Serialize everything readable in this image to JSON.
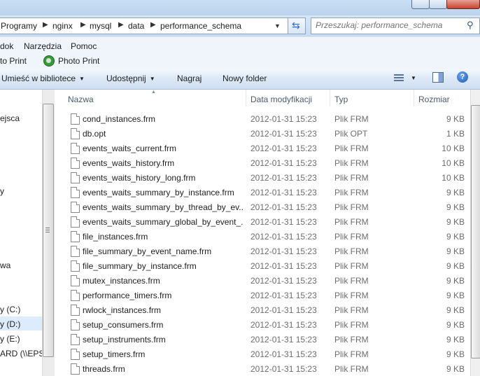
{
  "address": {
    "crumbs": [
      "Programy",
      "nginx",
      "mysql",
      "data",
      "performance_schema"
    ]
  },
  "search": {
    "placeholder": "Przeszukaj: performance_schema"
  },
  "menu": {
    "items": [
      "dok",
      "Narzędzia",
      "Pomoc"
    ]
  },
  "print_bar": {
    "left_label": "to Print",
    "photo_print_label": "Photo Print"
  },
  "command_bar": {
    "library_label": "Umieść w bibliotece",
    "share_label": "Udostępnij",
    "burn_label": "Nagraj",
    "new_folder_label": "Nowy folder"
  },
  "nav": {
    "items": [
      "ejsca",
      "y",
      "wa",
      "y (C:)",
      "y (D:)",
      "y (E:)",
      "ARD (\\\\EPS("
    ],
    "selected": "y (D:)"
  },
  "columns": {
    "name": "Nazwa",
    "date": "Data modyfikacji",
    "type": "Typ",
    "size": "Rozmiar"
  },
  "files": [
    {
      "name": "cond_instances.frm",
      "date": "2012-01-31 15:23",
      "type": "Plik FRM",
      "size": "9 KB"
    },
    {
      "name": "db.opt",
      "date": "2012-01-31 15:23",
      "type": "Plik OPT",
      "size": "1 KB"
    },
    {
      "name": "events_waits_current.frm",
      "date": "2012-01-31 15:23",
      "type": "Plik FRM",
      "size": "10 KB"
    },
    {
      "name": "events_waits_history.frm",
      "date": "2012-01-31 15:23",
      "type": "Plik FRM",
      "size": "10 KB"
    },
    {
      "name": "events_waits_history_long.frm",
      "date": "2012-01-31 15:23",
      "type": "Plik FRM",
      "size": "10 KB"
    },
    {
      "name": "events_waits_summary_by_instance.frm",
      "date": "2012-01-31 15:23",
      "type": "Plik FRM",
      "size": "9 KB"
    },
    {
      "name": "events_waits_summary_by_thread_by_ev...",
      "date": "2012-01-31 15:23",
      "type": "Plik FRM",
      "size": "9 KB"
    },
    {
      "name": "events_waits_summary_global_by_event_...",
      "date": "2012-01-31 15:23",
      "type": "Plik FRM",
      "size": "9 KB"
    },
    {
      "name": "file_instances.frm",
      "date": "2012-01-31 15:23",
      "type": "Plik FRM",
      "size": "9 KB"
    },
    {
      "name": "file_summary_by_event_name.frm",
      "date": "2012-01-31 15:23",
      "type": "Plik FRM",
      "size": "9 KB"
    },
    {
      "name": "file_summary_by_instance.frm",
      "date": "2012-01-31 15:23",
      "type": "Plik FRM",
      "size": "9 KB"
    },
    {
      "name": "mutex_instances.frm",
      "date": "2012-01-31 15:23",
      "type": "Plik FRM",
      "size": "9 KB"
    },
    {
      "name": "performance_timers.frm",
      "date": "2012-01-31 15:23",
      "type": "Plik FRM",
      "size": "9 KB"
    },
    {
      "name": "rwlock_instances.frm",
      "date": "2012-01-31 15:23",
      "type": "Plik FRM",
      "size": "9 KB"
    },
    {
      "name": "setup_consumers.frm",
      "date": "2012-01-31 15:23",
      "type": "Plik FRM",
      "size": "9 KB"
    },
    {
      "name": "setup_instruments.frm",
      "date": "2012-01-31 15:23",
      "type": "Plik FRM",
      "size": "9 KB"
    },
    {
      "name": "setup_timers.frm",
      "date": "2012-01-31 15:23",
      "type": "Plik FRM",
      "size": "9 KB"
    },
    {
      "name": "threads.frm",
      "date": "2012-01-31 15:23",
      "type": "Plik FRM",
      "size": "9 KB"
    }
  ],
  "icons": {
    "refresh": "refresh-icon",
    "search": "search-icon",
    "photo": "photo-print-icon",
    "views": "change-view-icon",
    "preview": "preview-pane-icon",
    "help": "help-icon",
    "file": "file-icon"
  }
}
